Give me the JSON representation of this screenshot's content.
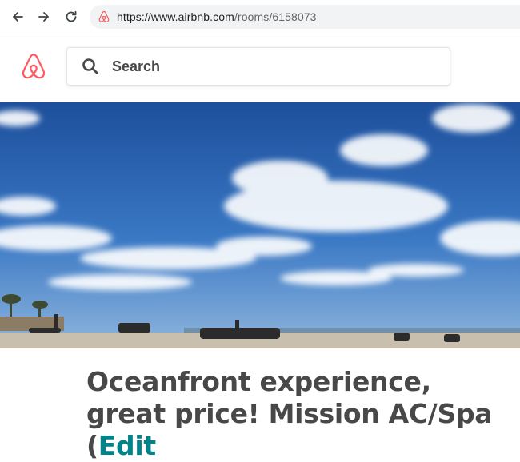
{
  "browser": {
    "url_host": "https://www.airbnb.com",
    "url_path": "/rooms/6158073",
    "icons": [
      "back-arrow-icon",
      "forward-arrow-icon",
      "reload-icon",
      "airbnb-favicon"
    ]
  },
  "header": {
    "logo": "airbnb-logo",
    "search_placeholder": "Search"
  },
  "listing": {
    "title": "Oceanfront experience, great price! Mission AC/Spa (",
    "edit_label": "Edit"
  },
  "colors": {
    "brand": "#FF5A5F",
    "link": "#008489",
    "text": "#484848"
  }
}
